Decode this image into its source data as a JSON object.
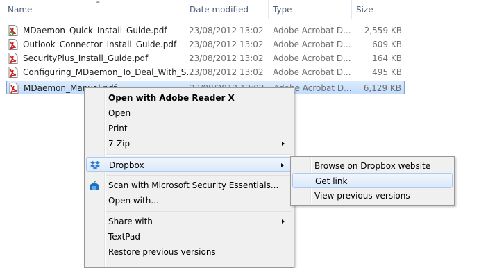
{
  "columns": {
    "name": "Name",
    "date_modified": "Date modified",
    "type": "Type",
    "size": "Size"
  },
  "files": [
    {
      "name": "MDaemon_Quick_Install_Guide.pdf",
      "date": "23/08/2012 13:02",
      "type": "Adobe Acrobat D...",
      "size": "2,559 KB",
      "icon": "pdf-shared-icon"
    },
    {
      "name": "Outlook_Connector_Install_Guide.pdf",
      "date": "23/08/2012 13:02",
      "type": "Adobe Acrobat D...",
      "size": "609 KB",
      "icon": "pdf-icon"
    },
    {
      "name": "SecurityPlus_Install_Guide.pdf",
      "date": "23/08/2012 13:02",
      "type": "Adobe Acrobat D...",
      "size": "164 KB",
      "icon": "pdf-icon"
    },
    {
      "name": "Configuring_MDaemon_To_Deal_With_S...",
      "date": "23/08/2012 13:02",
      "type": "Adobe Acrobat D...",
      "size": "495 KB",
      "icon": "pdf-icon"
    },
    {
      "name": "MDaemon_Manual.pdf",
      "date": "23/08/2012 13:02",
      "type": "Adobe Acrobat D...",
      "size": "6,129 KB",
      "icon": "pdf-icon",
      "selected": true
    }
  ],
  "context_menu": {
    "open_with_reader": "Open with Adobe Reader X",
    "open": "Open",
    "print": "Print",
    "seven_zip": "7-Zip",
    "dropbox": "Dropbox",
    "scan": "Scan with Microsoft Security Essentials...",
    "open_with": "Open with...",
    "share_with": "Share with",
    "textpad": "TextPad",
    "restore": "Restore previous versions"
  },
  "dropbox_submenu": {
    "browse": "Browse on Dropbox website",
    "get_link": "Get link",
    "view_versions": "View previous versions"
  },
  "colors": {
    "selection_border": "#7da2ce",
    "menu_bg": "#f0f0f0",
    "hover_border": "#aeccf1",
    "pdf_red": "#c8201e",
    "dropbox_blue": "#2e7dd1"
  }
}
